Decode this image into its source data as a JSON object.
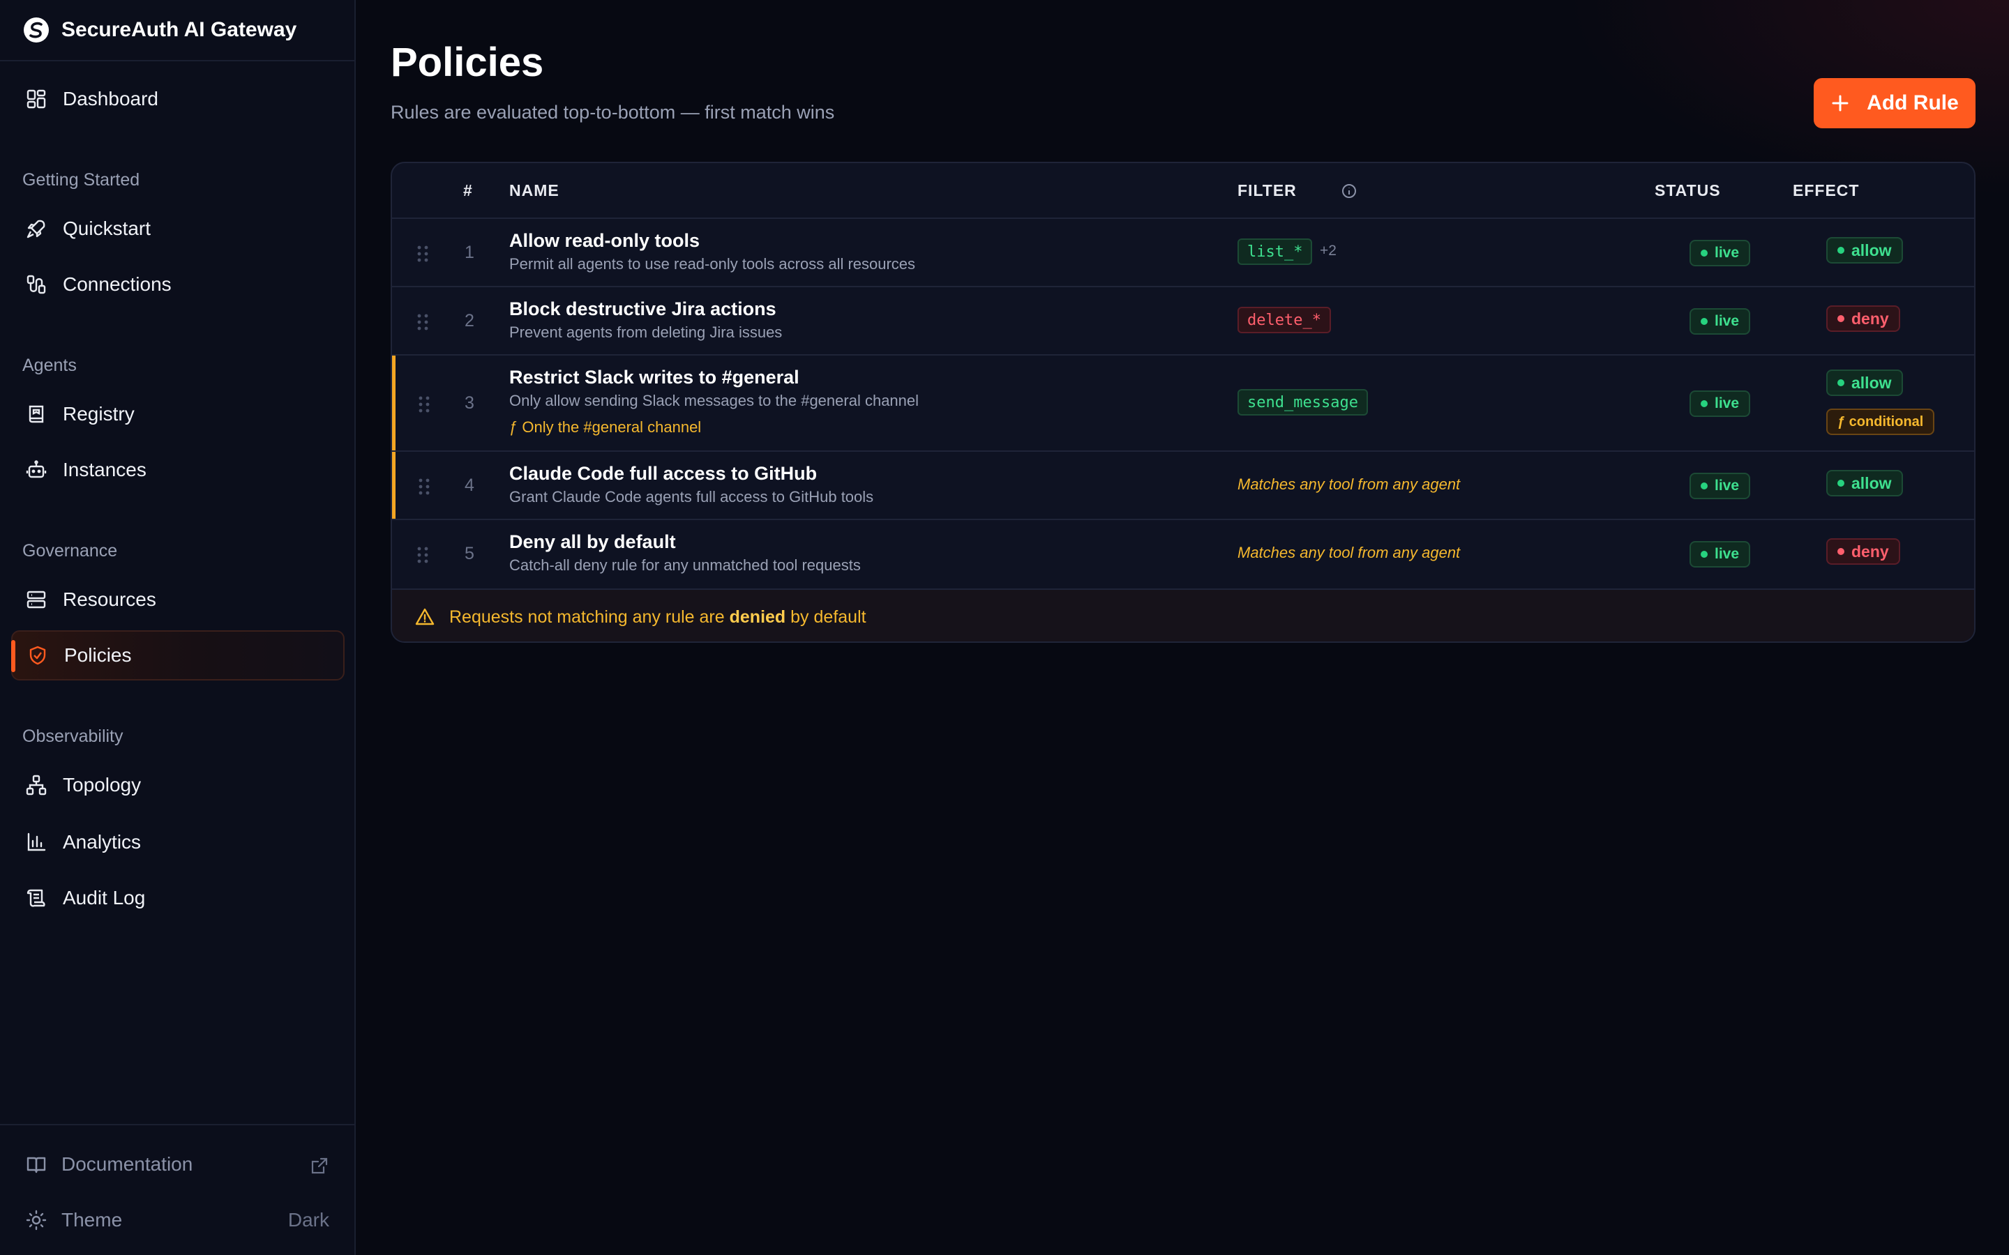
{
  "app": {
    "name": "SecureAuth AI Gateway"
  },
  "nav": {
    "dashboard": "Dashboard",
    "sections": {
      "getting_started": "Getting Started",
      "agents": "Agents",
      "governance": "Governance",
      "observability": "Observability"
    },
    "quickstart": "Quickstart",
    "connections": "Connections",
    "registry": "Registry",
    "instances": "Instances",
    "resources": "Resources",
    "policies": "Policies",
    "topology": "Topology",
    "analytics": "Analytics",
    "audit_log": "Audit Log"
  },
  "footer": {
    "documentation": "Documentation",
    "theme_label": "Theme",
    "theme_value": "Dark"
  },
  "page": {
    "title": "Policies",
    "subtitle": "Rules are evaluated top-to-bottom — first match wins",
    "add_button": "Add Rule"
  },
  "table": {
    "headers": {
      "num": "#",
      "name": "NAME",
      "filter": "FILTER",
      "status": "STATUS",
      "effect": "EFFECT"
    },
    "rows": [
      {
        "num": "1",
        "name": "Allow read-only tools",
        "desc": "Permit all agents to use read-only tools across all resources",
        "filter": "list_*",
        "more": "+2",
        "status": "live",
        "effect": "allow"
      },
      {
        "num": "2",
        "name": "Block destructive Jira actions",
        "desc": "Prevent agents from deleting Jira issues",
        "filter": "delete_*",
        "status": "live",
        "effect": "deny"
      },
      {
        "num": "3",
        "name": "Restrict Slack writes to #general",
        "desc": "Only allow sending Slack messages to the #general channel",
        "condition": "ƒ Only the #general channel",
        "filter": "send_message",
        "status": "live",
        "effect": "allow",
        "effect_extra": "ƒ conditional"
      },
      {
        "num": "4",
        "name": "Claude Code full access to GitHub",
        "desc": "Grant Claude Code agents full access to GitHub tools",
        "filter": "Matches any tool from any agent",
        "status": "live",
        "effect": "allow"
      },
      {
        "num": "5",
        "name": "Deny all by default",
        "desc": "Catch-all deny rule for any unmatched tool requests",
        "filter": "Matches any tool from any agent",
        "status": "live",
        "effect": "deny"
      }
    ],
    "footer_note": {
      "before": "Requests not matching any rule are",
      "strong": "denied",
      "after": "by default"
    }
  },
  "colors": {
    "accent": "#ff5a1f",
    "allow": "#3ee08f",
    "deny": "#ff5f6d",
    "warning": "#f5b82e"
  }
}
